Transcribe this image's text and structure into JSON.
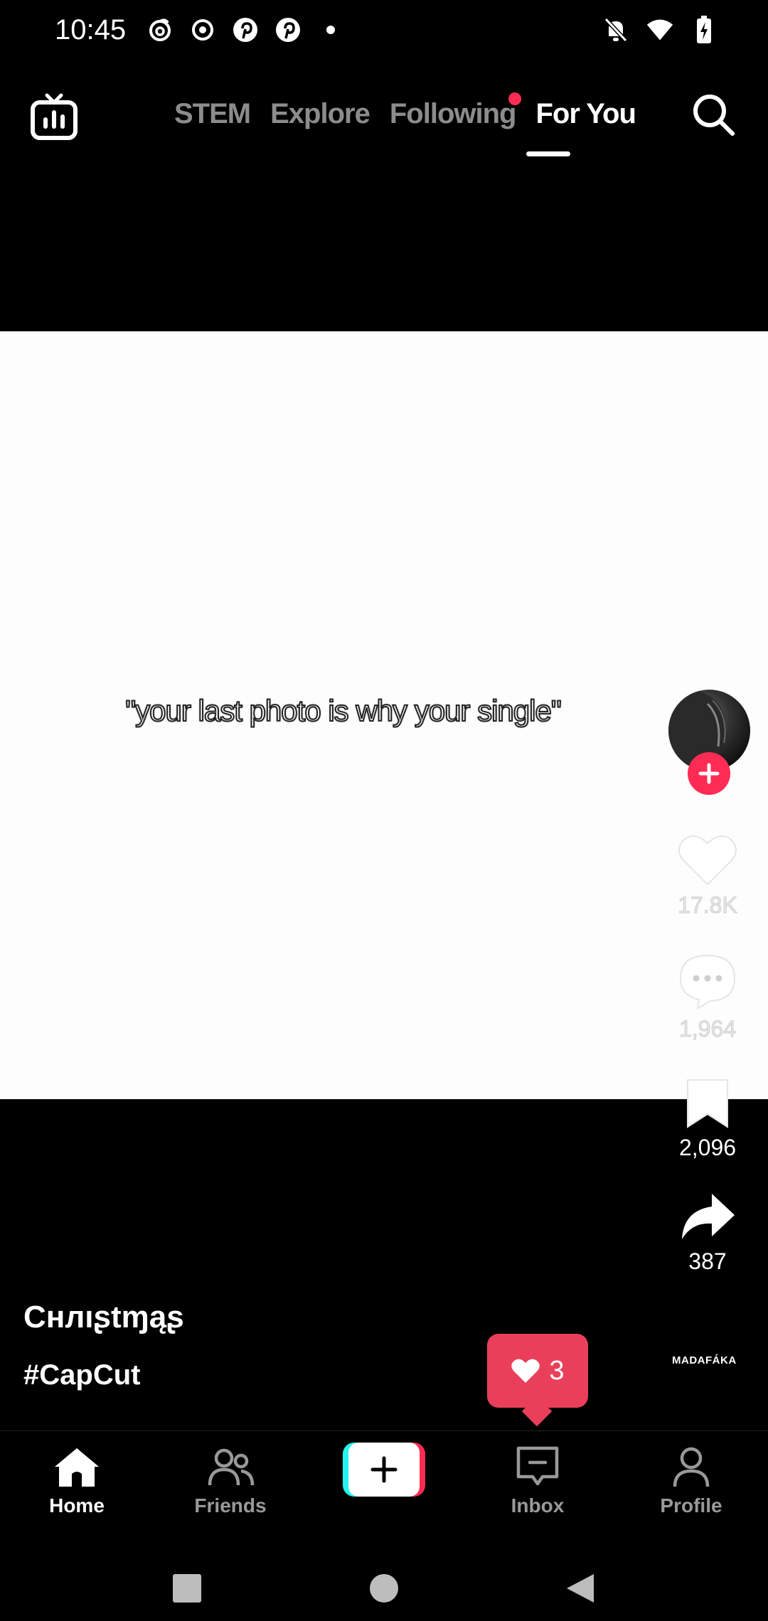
{
  "status_bar": {
    "time": "10:45",
    "left_icons": [
      "threads-icon",
      "circle-record-icon",
      "pinterest-icon",
      "pinterest-icon",
      "dot-icon"
    ],
    "right_icons": [
      "bell-muted-icon",
      "wifi-icon",
      "battery-charging-icon"
    ]
  },
  "top_nav": {
    "tabs": [
      {
        "label": "STEM",
        "active": false
      },
      {
        "label": "Explore",
        "active": false
      },
      {
        "label": "Following",
        "active": false,
        "has_dot": true
      },
      {
        "label": "For You",
        "active": true
      }
    ]
  },
  "video": {
    "caption_overlay": "\"your last photo is why your single\""
  },
  "rail": {
    "likes": "17.8K",
    "comments": "1,964",
    "bookmarks": "2,096",
    "shares": "387"
  },
  "post": {
    "username": "Cнлıʂtɱąʂ",
    "hashtag": "#CapCut",
    "music_label": "MADAFÁKA"
  },
  "like_notification": {
    "count": "3"
  },
  "tabbar": {
    "home": "Home",
    "friends": "Friends",
    "inbox": "Inbox",
    "profile": "Profile"
  },
  "colors": {
    "accent": "#fe2c55",
    "cyan": "#25f4ee",
    "bubble": "#ea3f5b"
  }
}
